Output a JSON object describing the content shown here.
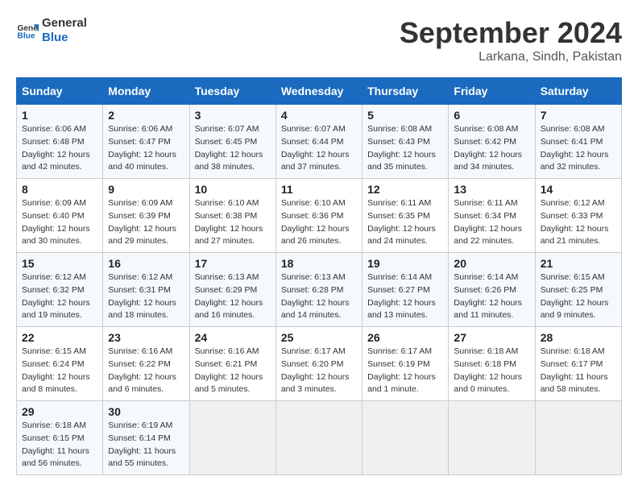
{
  "header": {
    "logo_line1": "General",
    "logo_line2": "Blue",
    "month": "September 2024",
    "location": "Larkana, Sindh, Pakistan"
  },
  "days_of_week": [
    "Sunday",
    "Monday",
    "Tuesday",
    "Wednesday",
    "Thursday",
    "Friday",
    "Saturday"
  ],
  "weeks": [
    [
      {
        "day": "1",
        "info": "Sunrise: 6:06 AM\nSunset: 6:48 PM\nDaylight: 12 hours\nand 42 minutes."
      },
      {
        "day": "2",
        "info": "Sunrise: 6:06 AM\nSunset: 6:47 PM\nDaylight: 12 hours\nand 40 minutes."
      },
      {
        "day": "3",
        "info": "Sunrise: 6:07 AM\nSunset: 6:45 PM\nDaylight: 12 hours\nand 38 minutes."
      },
      {
        "day": "4",
        "info": "Sunrise: 6:07 AM\nSunset: 6:44 PM\nDaylight: 12 hours\nand 37 minutes."
      },
      {
        "day": "5",
        "info": "Sunrise: 6:08 AM\nSunset: 6:43 PM\nDaylight: 12 hours\nand 35 minutes."
      },
      {
        "day": "6",
        "info": "Sunrise: 6:08 AM\nSunset: 6:42 PM\nDaylight: 12 hours\nand 34 minutes."
      },
      {
        "day": "7",
        "info": "Sunrise: 6:08 AM\nSunset: 6:41 PM\nDaylight: 12 hours\nand 32 minutes."
      }
    ],
    [
      {
        "day": "8",
        "info": "Sunrise: 6:09 AM\nSunset: 6:40 PM\nDaylight: 12 hours\nand 30 minutes."
      },
      {
        "day": "9",
        "info": "Sunrise: 6:09 AM\nSunset: 6:39 PM\nDaylight: 12 hours\nand 29 minutes."
      },
      {
        "day": "10",
        "info": "Sunrise: 6:10 AM\nSunset: 6:38 PM\nDaylight: 12 hours\nand 27 minutes."
      },
      {
        "day": "11",
        "info": "Sunrise: 6:10 AM\nSunset: 6:36 PM\nDaylight: 12 hours\nand 26 minutes."
      },
      {
        "day": "12",
        "info": "Sunrise: 6:11 AM\nSunset: 6:35 PM\nDaylight: 12 hours\nand 24 minutes."
      },
      {
        "day": "13",
        "info": "Sunrise: 6:11 AM\nSunset: 6:34 PM\nDaylight: 12 hours\nand 22 minutes."
      },
      {
        "day": "14",
        "info": "Sunrise: 6:12 AM\nSunset: 6:33 PM\nDaylight: 12 hours\nand 21 minutes."
      }
    ],
    [
      {
        "day": "15",
        "info": "Sunrise: 6:12 AM\nSunset: 6:32 PM\nDaylight: 12 hours\nand 19 minutes."
      },
      {
        "day": "16",
        "info": "Sunrise: 6:12 AM\nSunset: 6:31 PM\nDaylight: 12 hours\nand 18 minutes."
      },
      {
        "day": "17",
        "info": "Sunrise: 6:13 AM\nSunset: 6:29 PM\nDaylight: 12 hours\nand 16 minutes."
      },
      {
        "day": "18",
        "info": "Sunrise: 6:13 AM\nSunset: 6:28 PM\nDaylight: 12 hours\nand 14 minutes."
      },
      {
        "day": "19",
        "info": "Sunrise: 6:14 AM\nSunset: 6:27 PM\nDaylight: 12 hours\nand 13 minutes."
      },
      {
        "day": "20",
        "info": "Sunrise: 6:14 AM\nSunset: 6:26 PM\nDaylight: 12 hours\nand 11 minutes."
      },
      {
        "day": "21",
        "info": "Sunrise: 6:15 AM\nSunset: 6:25 PM\nDaylight: 12 hours\nand 9 minutes."
      }
    ],
    [
      {
        "day": "22",
        "info": "Sunrise: 6:15 AM\nSunset: 6:24 PM\nDaylight: 12 hours\nand 8 minutes."
      },
      {
        "day": "23",
        "info": "Sunrise: 6:16 AM\nSunset: 6:22 PM\nDaylight: 12 hours\nand 6 minutes."
      },
      {
        "day": "24",
        "info": "Sunrise: 6:16 AM\nSunset: 6:21 PM\nDaylight: 12 hours\nand 5 minutes."
      },
      {
        "day": "25",
        "info": "Sunrise: 6:17 AM\nSunset: 6:20 PM\nDaylight: 12 hours\nand 3 minutes."
      },
      {
        "day": "26",
        "info": "Sunrise: 6:17 AM\nSunset: 6:19 PM\nDaylight: 12 hours\nand 1 minute."
      },
      {
        "day": "27",
        "info": "Sunrise: 6:18 AM\nSunset: 6:18 PM\nDaylight: 12 hours\nand 0 minutes."
      },
      {
        "day": "28",
        "info": "Sunrise: 6:18 AM\nSunset: 6:17 PM\nDaylight: 11 hours\nand 58 minutes."
      }
    ],
    [
      {
        "day": "29",
        "info": "Sunrise: 6:18 AM\nSunset: 6:15 PM\nDaylight: 11 hours\nand 56 minutes."
      },
      {
        "day": "30",
        "info": "Sunrise: 6:19 AM\nSunset: 6:14 PM\nDaylight: 11 hours\nand 55 minutes."
      },
      {
        "day": "",
        "info": ""
      },
      {
        "day": "",
        "info": ""
      },
      {
        "day": "",
        "info": ""
      },
      {
        "day": "",
        "info": ""
      },
      {
        "day": "",
        "info": ""
      }
    ]
  ]
}
